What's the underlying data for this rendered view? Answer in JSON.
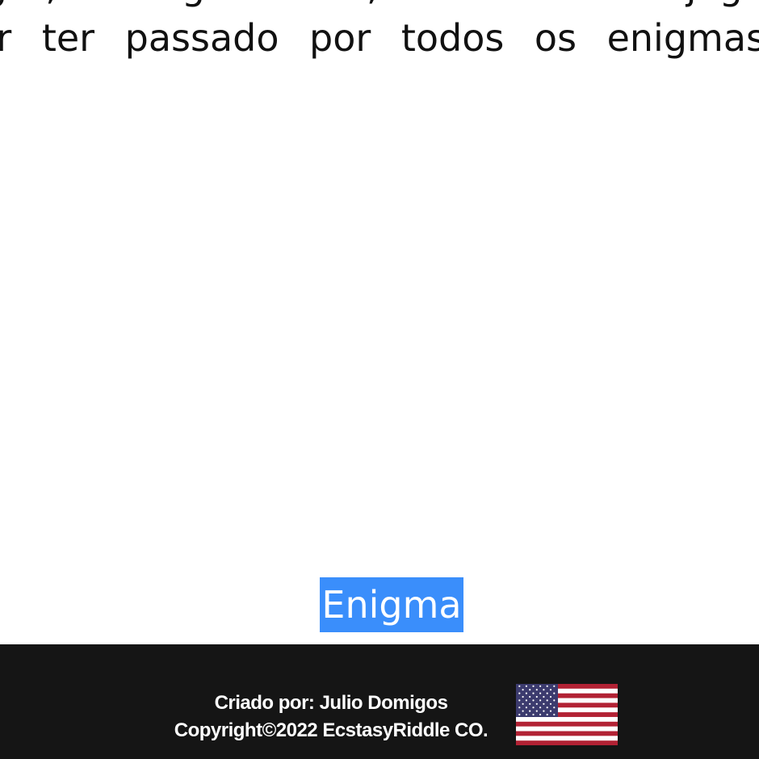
{
  "content": {
    "line1": "lugar, o enigma final, e no final do jogo",
    "line2": "por ter passado por todos os enigmas"
  },
  "button": {
    "label": "Enigma"
  },
  "footer": {
    "created_by": "Criado por: Julio Domigos",
    "copyright": "Copyright©2022 EcstasyRiddle CO.",
    "language_icon": "us-flag-icon"
  },
  "colors": {
    "button_bg": "#3a8efb",
    "footer_bg": "#151515",
    "flag_red": "#b22234",
    "flag_blue": "#3c3b6e"
  }
}
